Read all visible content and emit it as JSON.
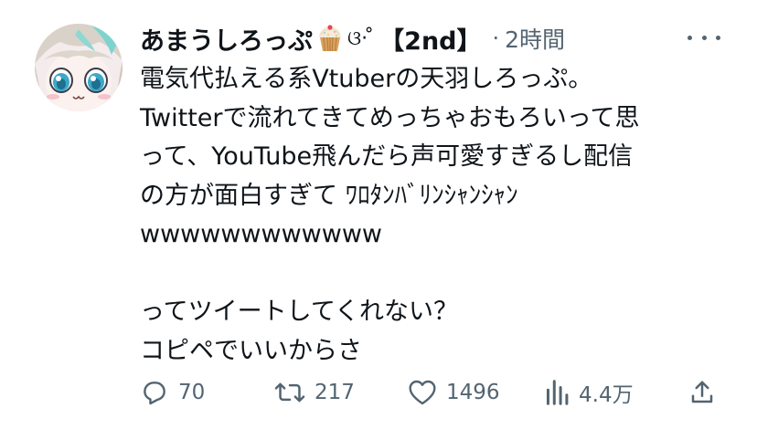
{
  "tweet": {
    "display_name": "あまうしろっぷ",
    "name_emoji": "cupcake-icon",
    "name_kaomoji": "ଓ· ̊",
    "name_tag": "【2nd】",
    "separator": "·",
    "time": "2時間",
    "lines": [
      "電気代払える系Vtuberの天羽しろっぷ。",
      "Twitterで流れてきてめっちゃおもろいって思",
      "って、YouTube飛んだら声可愛すぎるし配信",
      "の方が面白すぎて ﾜﾛﾀﾝﾊﾞﾘﾝｼｬﾝｼｬﾝ",
      "wwwwwwwwwwww",
      "",
      "ってツイートしてくれない？",
      "コピペでいいからさ"
    ],
    "metrics": {
      "replies": "70",
      "retweets": "217",
      "likes": "1496",
      "views": "4.4万"
    }
  },
  "colors": {
    "text": "#0f1419",
    "secondary": "#536471",
    "background": "#ffffff"
  }
}
